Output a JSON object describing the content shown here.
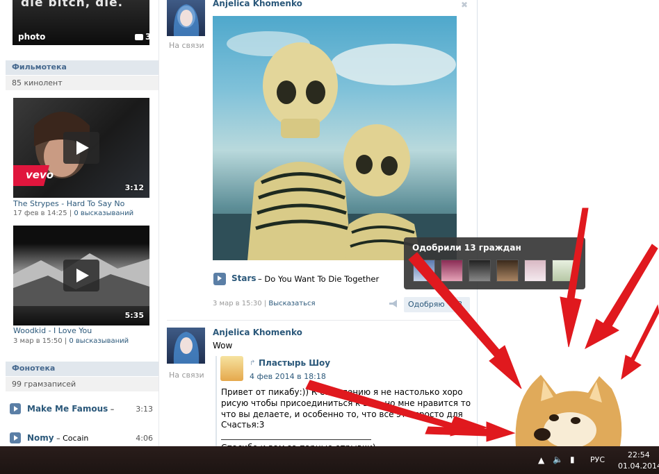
{
  "left": {
    "photo_label": "photo",
    "photo_count": "3",
    "photo_banner": "die bitch, die.",
    "films": {
      "title": "Фильмотека",
      "count": "85 кинолент",
      "videos": [
        {
          "title": "The Strypes - Hard To Say No",
          "date": "17 фев в 14:25",
          "sep": " | ",
          "comments": "0 высказываний",
          "duration": "3:12",
          "badge": "vevo"
        },
        {
          "title": "Woodkid - I Love You",
          "date": "3 мар в 15:50",
          "sep": " | ",
          "comments": "0 высказываний",
          "duration": "5:35"
        }
      ]
    },
    "audio": {
      "title": "Фонотека",
      "count": "99 грамзаписей",
      "tracks": [
        {
          "artist": "Make Me Famous",
          "title": " – ",
          "duration": "3:13"
        },
        {
          "artist": "Nomy",
          "title": " – Cocain",
          "duration": "4:06"
        }
      ]
    }
  },
  "posts": [
    {
      "author": "Anjelica Khomenko",
      "status": "На связи",
      "audio_artist": "Stars",
      "audio_title": " – Do You Want To Die Together",
      "date": "3 мар в 15:30",
      "sep": " | ",
      "comment_link": "Высказаться",
      "like_label": "Одобряю",
      "like_count": "13"
    },
    {
      "author": "Anjelica Khomenko",
      "status": "На связи",
      "text": "Wow",
      "repost": {
        "author": "Пластырь Шоу",
        "date": "4 фев 2014 в 18:18",
        "lines": [
          "Привет от пикабу:)) К сожалению я не настолько хоро",
          "рисую чтобы присоединиться к вам, но мне нравится то",
          "что вы делаете, и особенно то, что все это просто для",
          "Счастья:3",
          "Спасибо и вам за парные отрывки)"
        ]
      }
    }
  ],
  "tooltip": {
    "title": "Одобрили 13 граждан",
    "avatars": 6
  },
  "taskbar": {
    "lang": "РУС",
    "time": "22:54",
    "date": "01.04.2014"
  }
}
